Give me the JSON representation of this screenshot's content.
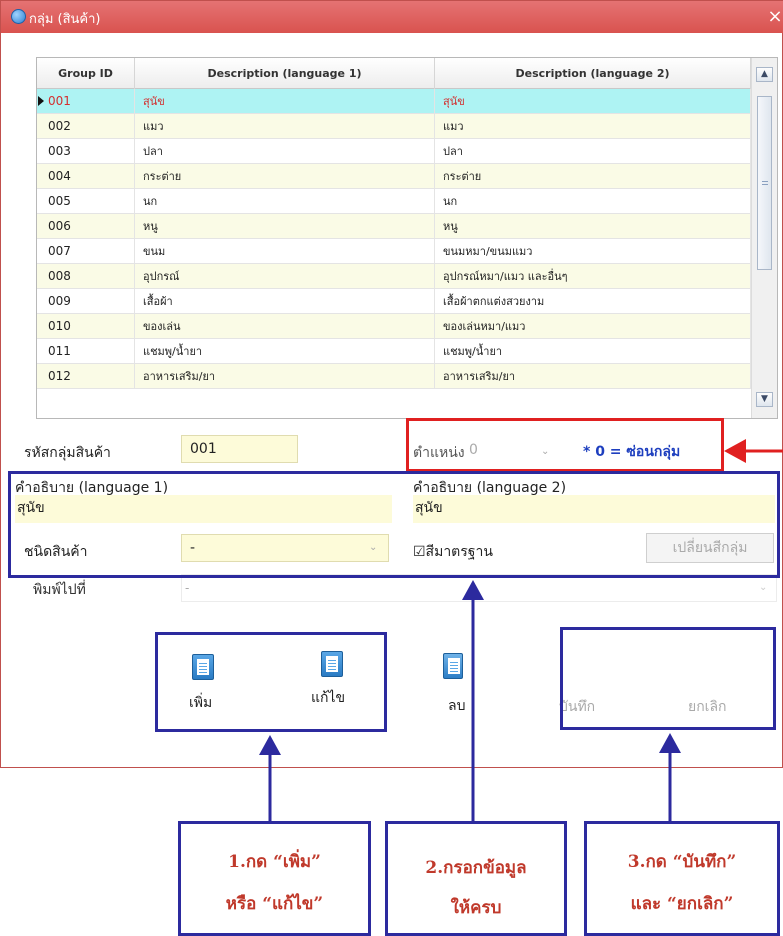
{
  "window": {
    "title": "กลุ่ม (สินค้า)",
    "close_glyph": "×"
  },
  "grid": {
    "columns": [
      "Group ID",
      "Description (language 1)",
      "Description (language 2)"
    ],
    "rows": [
      {
        "id": "001",
        "desc1": "สุนัข",
        "desc2": "สุนัข",
        "selected": true
      },
      {
        "id": "002",
        "desc1": "แมว",
        "desc2": "แมว"
      },
      {
        "id": "003",
        "desc1": "ปลา",
        "desc2": "ปลา"
      },
      {
        "id": "004",
        "desc1": "กระต่าย",
        "desc2": "กระต่าย"
      },
      {
        "id": "005",
        "desc1": "นก",
        "desc2": "นก"
      },
      {
        "id": "006",
        "desc1": "หนู",
        "desc2": "หนู"
      },
      {
        "id": "007",
        "desc1": "ขนม",
        "desc2": "ขนมหมา/ขนมแมว"
      },
      {
        "id": "008",
        "desc1": "อุปกรณ์",
        "desc2": "อุปกรณ์หมา/แมว และอื่นๆ"
      },
      {
        "id": "009",
        "desc1": "เสื้อผ้า",
        "desc2": "เสื้อผ้าตกแต่งสวยงาม"
      },
      {
        "id": "010",
        "desc1": "ของเล่น",
        "desc2": "ของเล่นหมา/แมว"
      },
      {
        "id": "011",
        "desc1": "แชมพู/น้ำยา",
        "desc2": "แชมพู/น้ำยา"
      },
      {
        "id": "012",
        "desc1": "อาหารเสริม/ยา",
        "desc2": "อาหารเสริม/ยา"
      }
    ],
    "scroll_up": "▲",
    "scroll_down": "▼"
  },
  "form": {
    "group_code_label": "รหัสกลุ่มสินค้า",
    "group_code_value": "001",
    "position_label": "ตำแหน่ง",
    "position_value": "0",
    "position_note": "* 0 = ซ่อนกลุ่ม",
    "desc1_label": "คำอธิบาย (language 1)",
    "desc1_value": "สุนัข",
    "desc2_label": "คำอธิบาย (language 2)",
    "desc2_value": "สุนัข",
    "product_type_label": "ชนิดสินค้า",
    "product_type_value": "-",
    "standard_color_label": "☑สีมาตรฐาน",
    "change_color_button": "เปลี่ยนสีกลุ่ม",
    "print_to_label": "พิมพ์ไปที่",
    "print_to_value": "-"
  },
  "toolbar": {
    "add": "เพิ่ม",
    "edit": "แก้ไข",
    "delete": "ลบ",
    "save": "บันทึก",
    "cancel": "ยกเลิก"
  },
  "callouts": {
    "step1_line1": "1.กด “เพิ่ม”",
    "step1_line2": "หรือ “แก้ไข”",
    "step2_line1": "2.กรอกข้อมูล",
    "step2_line2": "ให้ครบ",
    "step3_line1": "3.กด “บันทึก”",
    "step3_line2": "และ “ยกเลิก”"
  },
  "colors": {
    "title_bar": "#d9534f",
    "selected_row": "#aef3f3",
    "alt_row": "#fafbe6",
    "field_bg": "#fdfbd9",
    "annotation_red": "#e02020",
    "annotation_blue": "#2c2a9e",
    "callout_text": "#c0392b"
  }
}
